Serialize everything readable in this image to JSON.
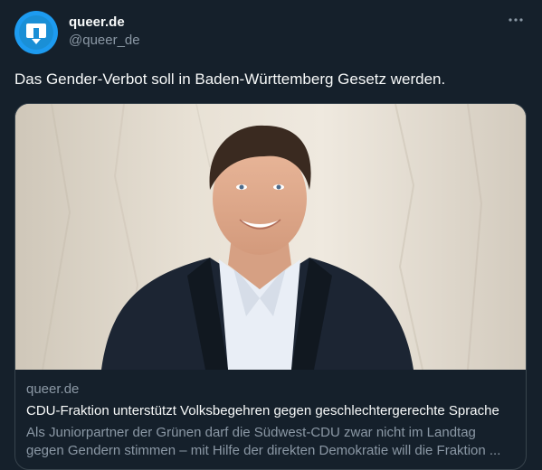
{
  "account": {
    "display_name": "queer.de",
    "handle": "@queer_de"
  },
  "tweet": {
    "text": "Das Gender-Verbot soll in Baden-Württemberg Gesetz werden."
  },
  "card": {
    "domain": "queer.de",
    "title": "CDU-Fraktion unterstützt Volksbegehren gegen geschlechtergerechte Sprache",
    "description_line1": "Als Juniorpartner der Grünen darf die Südwest-CDU zwar nicht im Landtag",
    "description_line2": "gegen Gendern stimmen – mit Hilfe der direkten Demokratie will die Fraktion ..."
  },
  "icons": {
    "avatar": "queer-de-logo-icon",
    "more": "more-options-icon"
  },
  "colors": {
    "background": "#15202b",
    "accent": "#1d9bf0",
    "text": "#f7f9f9",
    "secondary_text": "#8b98a5",
    "border": "#38444d"
  }
}
